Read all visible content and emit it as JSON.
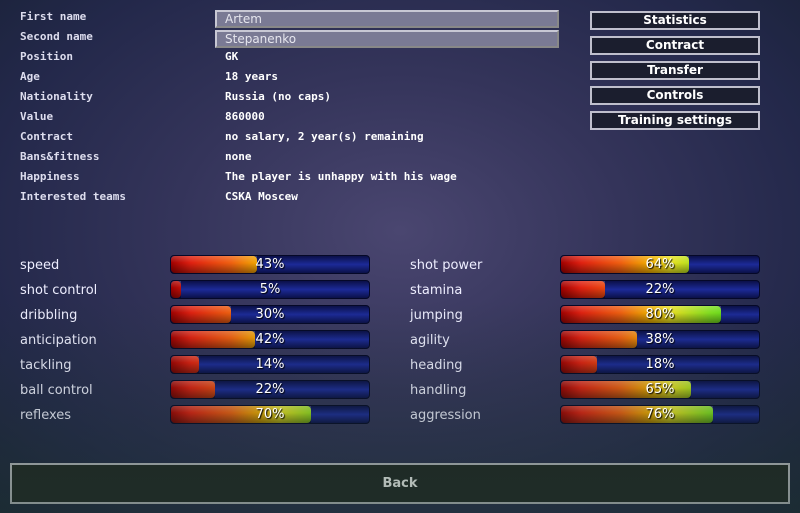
{
  "info": [
    {
      "label": "First name",
      "value": "Artem",
      "editable": true
    },
    {
      "label": "Second name",
      "value": "Stepanenko",
      "editable": true
    },
    {
      "label": "Position",
      "value": "GK"
    },
    {
      "label": "Age",
      "value": "18 years"
    },
    {
      "label": "Nationality",
      "value": "Russia (no caps)"
    },
    {
      "label": "Value",
      "value": "860000"
    },
    {
      "label": "Contract",
      "value": "no salary, 2 year(s) remaining"
    },
    {
      "label": "Bans&fitness",
      "value": "none"
    },
    {
      "label": "Happiness",
      "value": "The player is unhappy with his wage"
    },
    {
      "label": "Interested teams",
      "value": "CSKA Moscew"
    }
  ],
  "buttons": [
    "Statistics",
    "Contract",
    "Transfer",
    "Controls",
    "Training settings"
  ],
  "skills_left": [
    {
      "name": "speed",
      "value": 43,
      "label": "43%"
    },
    {
      "name": "shot control",
      "value": 5,
      "label": "5%"
    },
    {
      "name": "dribbling",
      "value": 30,
      "label": "30%"
    },
    {
      "name": "anticipation",
      "value": 42,
      "label": "42%"
    },
    {
      "name": "tackling",
      "value": 14,
      "label": "14%"
    },
    {
      "name": "ball control",
      "value": 22,
      "label": "22%"
    },
    {
      "name": "reflexes",
      "value": 70,
      "label": "70%"
    }
  ],
  "skills_right": [
    {
      "name": "shot power",
      "value": 64,
      "label": "64%"
    },
    {
      "name": "stamina",
      "value": 22,
      "label": "22%"
    },
    {
      "name": "jumping",
      "value": 80,
      "label": "80%"
    },
    {
      "name": "agility",
      "value": 38,
      "label": "38%"
    },
    {
      "name": "heading",
      "value": 18,
      "label": "18%"
    },
    {
      "name": "handling",
      "value": 65,
      "label": "65%"
    },
    {
      "name": "aggression",
      "value": 76,
      "label": "76%"
    }
  ],
  "back_label": "Back"
}
